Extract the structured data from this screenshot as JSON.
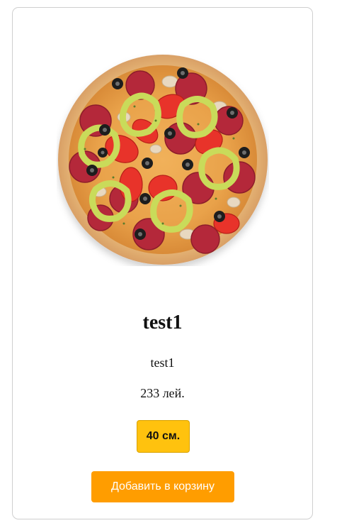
{
  "product": {
    "image_alt": "pizza-image",
    "title": "test1",
    "description": "test1",
    "price": "233 лей.",
    "size_label": "40 см.",
    "add_to_cart_label": "Добавить в корзину"
  },
  "colors": {
    "size_button": "#ffc20e",
    "add_button": "#ff9d00",
    "card_border": "#cfcfcf"
  }
}
